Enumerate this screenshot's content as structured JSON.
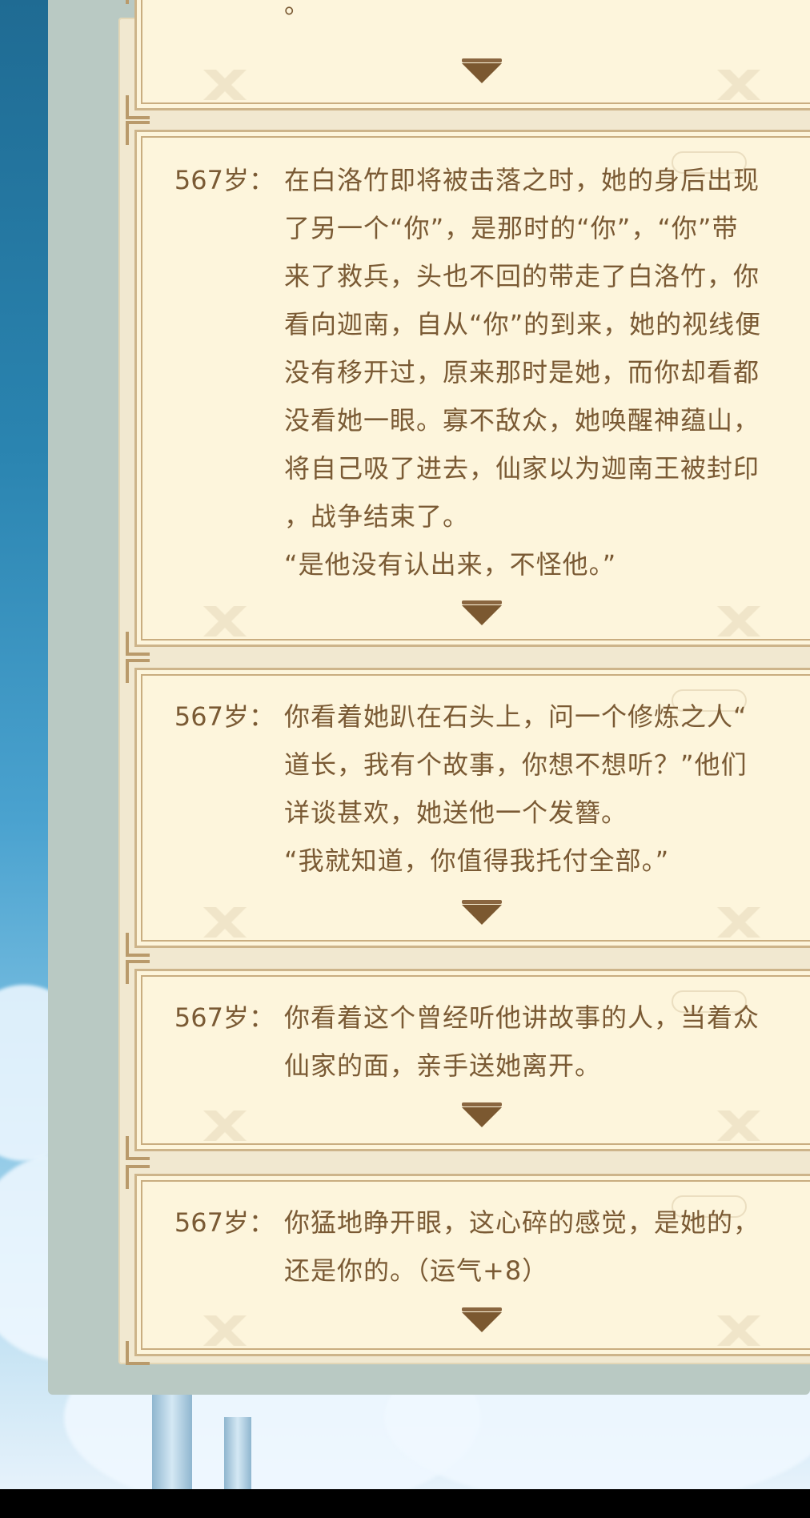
{
  "entries": [
    {
      "age": "",
      "lines": [
        "。"
      ]
    },
    {
      "age": "567岁：",
      "lines": [
        "在白洛竹即将被击落之时，她的身后出现",
        "了另一个“你”，是那时的“你”，“你”带",
        "来了救兵，头也不回的带走了白洛竹，你",
        "看向迦南，自从“你”的到来，她的视线便",
        "没有移开过，原来那时是她，而你却看都",
        "没看她一眼。寡不敌众，她唤醒神蕴山，",
        "将自己吸了进去，仙家以为迦南王被封印",
        "，战争结束了。",
        "“是他没有认出来，不怪他。”"
      ]
    },
    {
      "age": "567岁：",
      "lines": [
        "你看着她趴在石头上，问一个修炼之人“",
        "道长，我有个故事，你想不想听？”他们",
        "详谈甚欢，她送他一个发簪。",
        "“我就知道，你值得我托付全部。”"
      ]
    },
    {
      "age": "567岁：",
      "lines": [
        "你看着这个曾经听他讲故事的人，当着众",
        "仙家的面，亲手送她离开。"
      ]
    },
    {
      "age": "567岁：",
      "lines": [
        "你猛地睁开眼，这心碎的感觉，是她的，",
        "还是你的。（运气+8）"
      ]
    }
  ]
}
